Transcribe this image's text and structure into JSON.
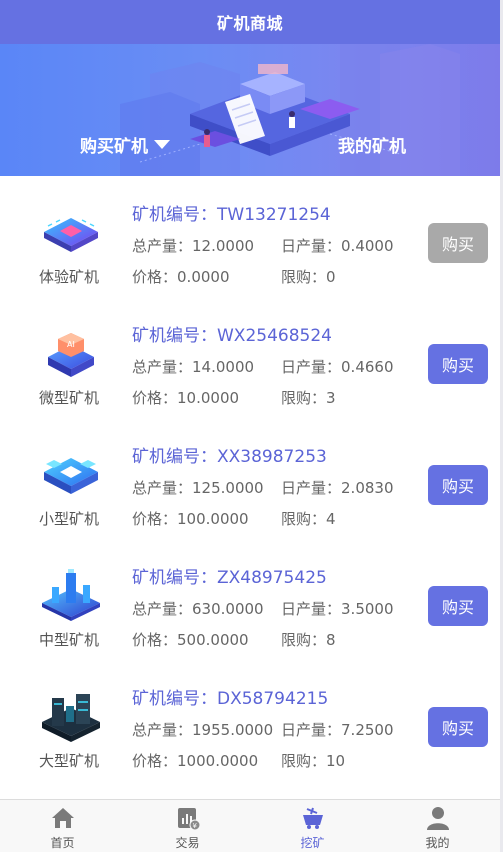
{
  "header": {
    "title": "矿机商城"
  },
  "banner": {
    "tab_buy": "购买矿机",
    "tab_mine": "我的矿机"
  },
  "labels": {
    "code": "矿机编号：",
    "total": "总产量：",
    "daily": "日产量：",
    "price": "价格：",
    "limit": "限购："
  },
  "machines": [
    {
      "name": "体验矿机",
      "code": "TW13271254",
      "total": "12.0000",
      "daily": "0.4000",
      "price": "0.0000",
      "limit": "0",
      "button": "购买",
      "disabled": true,
      "icon": "chip-icon"
    },
    {
      "name": "微型矿机",
      "code": "WX25468524",
      "total": "14.0000",
      "daily": "0.4660",
      "price": "10.0000",
      "limit": "3",
      "button": "购买",
      "disabled": false,
      "icon": "ai-chip-icon"
    },
    {
      "name": "小型矿机",
      "code": "XX38987253",
      "total": "125.0000",
      "daily": "2.0830",
      "price": "100.0000",
      "limit": "4",
      "button": "购买",
      "disabled": false,
      "icon": "server-block-icon"
    },
    {
      "name": "中型矿机",
      "code": "ZX48975425",
      "total": "630.0000",
      "daily": "3.5000",
      "price": "500.0000",
      "limit": "8",
      "button": "购买",
      "disabled": false,
      "icon": "data-tower-icon"
    },
    {
      "name": "大型矿机",
      "code": "DX58794215",
      "total": "1955.0000",
      "daily": "7.2500",
      "price": "1000.0000",
      "limit": "10",
      "button": "购买",
      "disabled": false,
      "icon": "dark-rig-icon"
    }
  ],
  "nav": {
    "items": [
      {
        "label": "首页",
        "icon": "home-icon"
      },
      {
        "label": "交易",
        "icon": "trade-chart-icon"
      },
      {
        "label": "挖矿",
        "icon": "mining-cart-icon",
        "active": true
      },
      {
        "label": "我的",
        "icon": "user-icon"
      }
    ]
  },
  "colors": {
    "primary": "#6571e2",
    "disabled": "#a9a9a9",
    "code_text": "#5b64d6"
  }
}
